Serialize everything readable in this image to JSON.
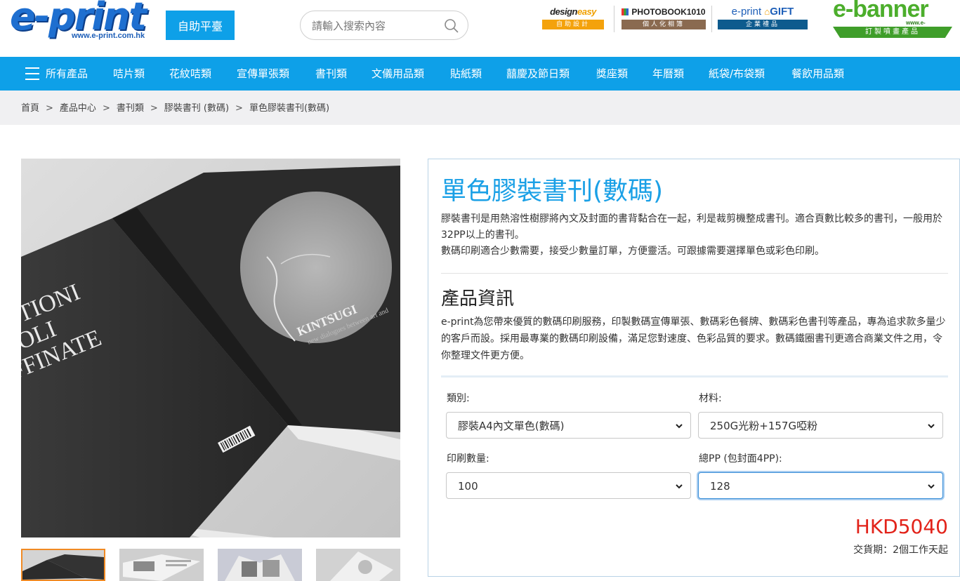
{
  "header": {
    "logo_text": "e-print",
    "logo_url": "www.e-print.com.hk",
    "self_service_button": "自助平臺",
    "search_placeholder": "請輸入搜索內容",
    "partners": [
      {
        "title_a": "design",
        "title_b": "easy",
        "sub": "自助設計"
      },
      {
        "title": "PHOTOBOOK1010",
        "sub": "個人化相簿"
      },
      {
        "title_a": "e-print",
        "title_b": "GIFT",
        "sub": "企業禮品"
      }
    ],
    "ebanner": {
      "title": "e-banner",
      "url": "www.e-banner.com",
      "sub": "訂製噴畫產品"
    }
  },
  "nav": {
    "items": [
      "所有產品",
      "咭片類",
      "花紋咭類",
      "宣傳單張類",
      "書刊類",
      "文儀用品類",
      "貼紙類",
      "囍慶及節日類",
      "獎座類",
      "年曆類",
      "紙袋/布袋類",
      "餐飲用品類"
    ]
  },
  "breadcrumb": [
    "首頁",
    "產品中心",
    "書刊類",
    "膠裝書刊 (數碼)",
    "單色膠裝書刊(數碼)"
  ],
  "product": {
    "title": "單色膠裝書刊(數碼)",
    "description_1": "膠裝書刊是用熱溶性樹膠將內文及封面的書背黏合在一起，利是裁剪機整成書刊。適合頁數比較多的書刊，一般用於32PP以上的書刊。",
    "description_2": "數碼印刷適合少數需要，接受少數量訂單，方便靈活。可跟據需要選擇單色或彩色印刷。",
    "info_heading": "產品資訊",
    "info_text": "e-print為您帶來優質的數碼印刷服務，印製數碼宣傳單張、數碼彩色餐牌、數碼彩色書刊等產品，專為追求款多量少的客戶而設。採用最專業的數碼印刷設備，滿足您對速度、色彩品質的要求。數碼鐵圈書刊更適合商業文件之用，令你整理文件更方便。",
    "options": {
      "type_label": "類別:",
      "type_value": "膠裝A4內文單色(數碼)",
      "material_label": "材料:",
      "material_value": "250G光粉+157G啞粉",
      "quantity_label": "印刷數量:",
      "quantity_value": "100",
      "pages_label": "總PP (包封面4PP):",
      "pages_value": "128"
    },
    "price": "HKD5040",
    "delivery": "交貨期：2個工作天起",
    "image_texts": {
      "left_cover_1": "ESTIONI",
      "left_cover_2": "VOLI",
      "left_cover_3": "FFINATE",
      "right_cover_1": "KINTSUGI",
      "right_cover_2": "new dialogues between art and"
    }
  },
  "colors": {
    "brand_blue": "#0ea0e8",
    "title_blue": "#1aa0e6",
    "price_red": "#e2231a",
    "thumb_active": "#f08a24"
  }
}
